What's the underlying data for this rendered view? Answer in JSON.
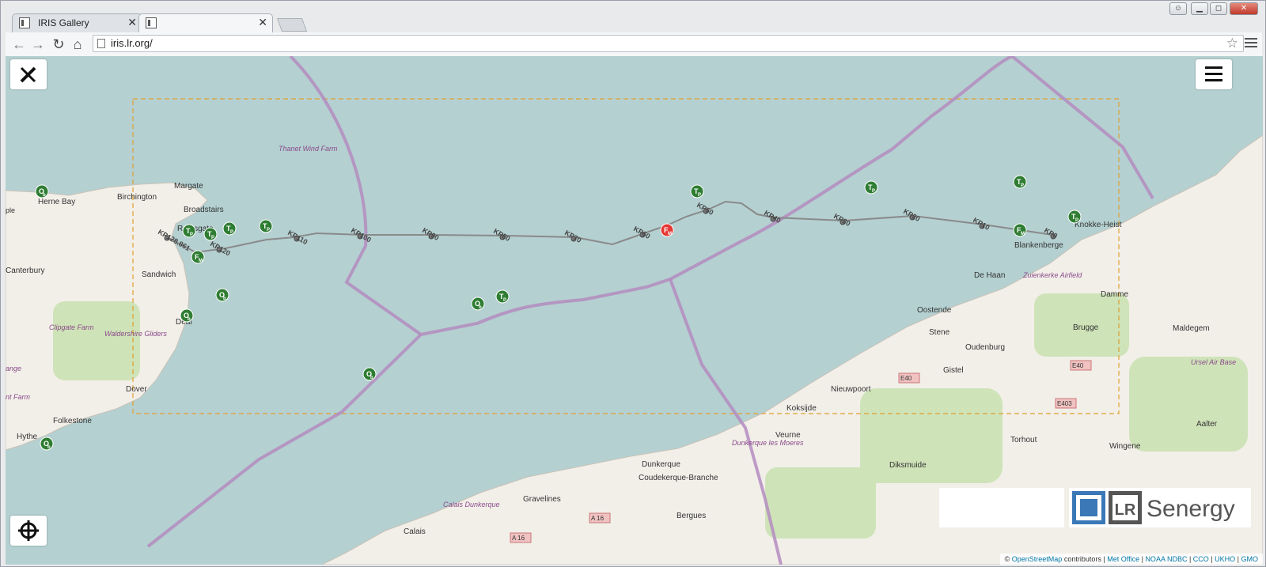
{
  "browser": {
    "tabs": [
      {
        "title": "IRIS Gallery"
      },
      {
        "title": ""
      }
    ],
    "url": "iris.lr.org/"
  },
  "map": {
    "towns_uk": [
      "Margate",
      "Birchington",
      "Herne Bay",
      "Broadstairs",
      "Ramsgate",
      "Sandwich",
      "Canterbury",
      "Deal",
      "Dover",
      "Folkestone",
      "Hythe"
    ],
    "towns_other": [
      "Knokke-Heist",
      "Blankenberge",
      "De Haan",
      "Damme",
      "Brugge",
      "Maldegem",
      "Oostende",
      "Stene",
      "Oudenburg",
      "Gistel",
      "Nieuwpoort",
      "Koksijde",
      "Veurne",
      "Diksmuide",
      "Torhout",
      "Wingene",
      "Aalter",
      "Dunkerque",
      "Coudekerque-Branche",
      "Bergues",
      "Gravelines",
      "Calais"
    ],
    "italic_labels": [
      "Thanet Wind Farm",
      "Clipgate Farm",
      "Waldershire Gliders",
      "Zuienkerke Airfield",
      "Ursel Air Base",
      "Dunkerque les Moeres",
      "Calais Dunkerque"
    ],
    "partial_labels": [
      "ple",
      "ange",
      "nt Farm"
    ],
    "roads": [
      "E40",
      "E403",
      "A 16"
    ],
    "kp_labels": [
      "KP128.861",
      "KP120",
      "KP110",
      "KP100",
      "KP90",
      "KP80",
      "KP70",
      "KP60",
      "KP50",
      "KP40",
      "KP30",
      "KP20",
      "KP10",
      "KP0"
    ],
    "marker_letters": {
      "tp": "T",
      "tp_sub": "P",
      "ob": "O",
      "ob_sub": "b",
      "fm": "F",
      "fm_sub": "M"
    }
  },
  "brand": {
    "text": "Senergy",
    "lr": "LR"
  },
  "attribution": {
    "prefix": "©",
    "osm": "OpenStreetMap",
    "contributors": "contributors |",
    "rest": [
      "Met Office",
      "NOAA NDBC",
      "CCO",
      "UKHO",
      "GMO"
    ]
  },
  "colors": {
    "sea": "#b4d0d1",
    "land": "#f2efe9",
    "border": "#b48cc0",
    "route": "#8a8a8a",
    "marker_green": "#2e7d32",
    "marker_red": "#e53935",
    "bbox": "#e0a030"
  }
}
